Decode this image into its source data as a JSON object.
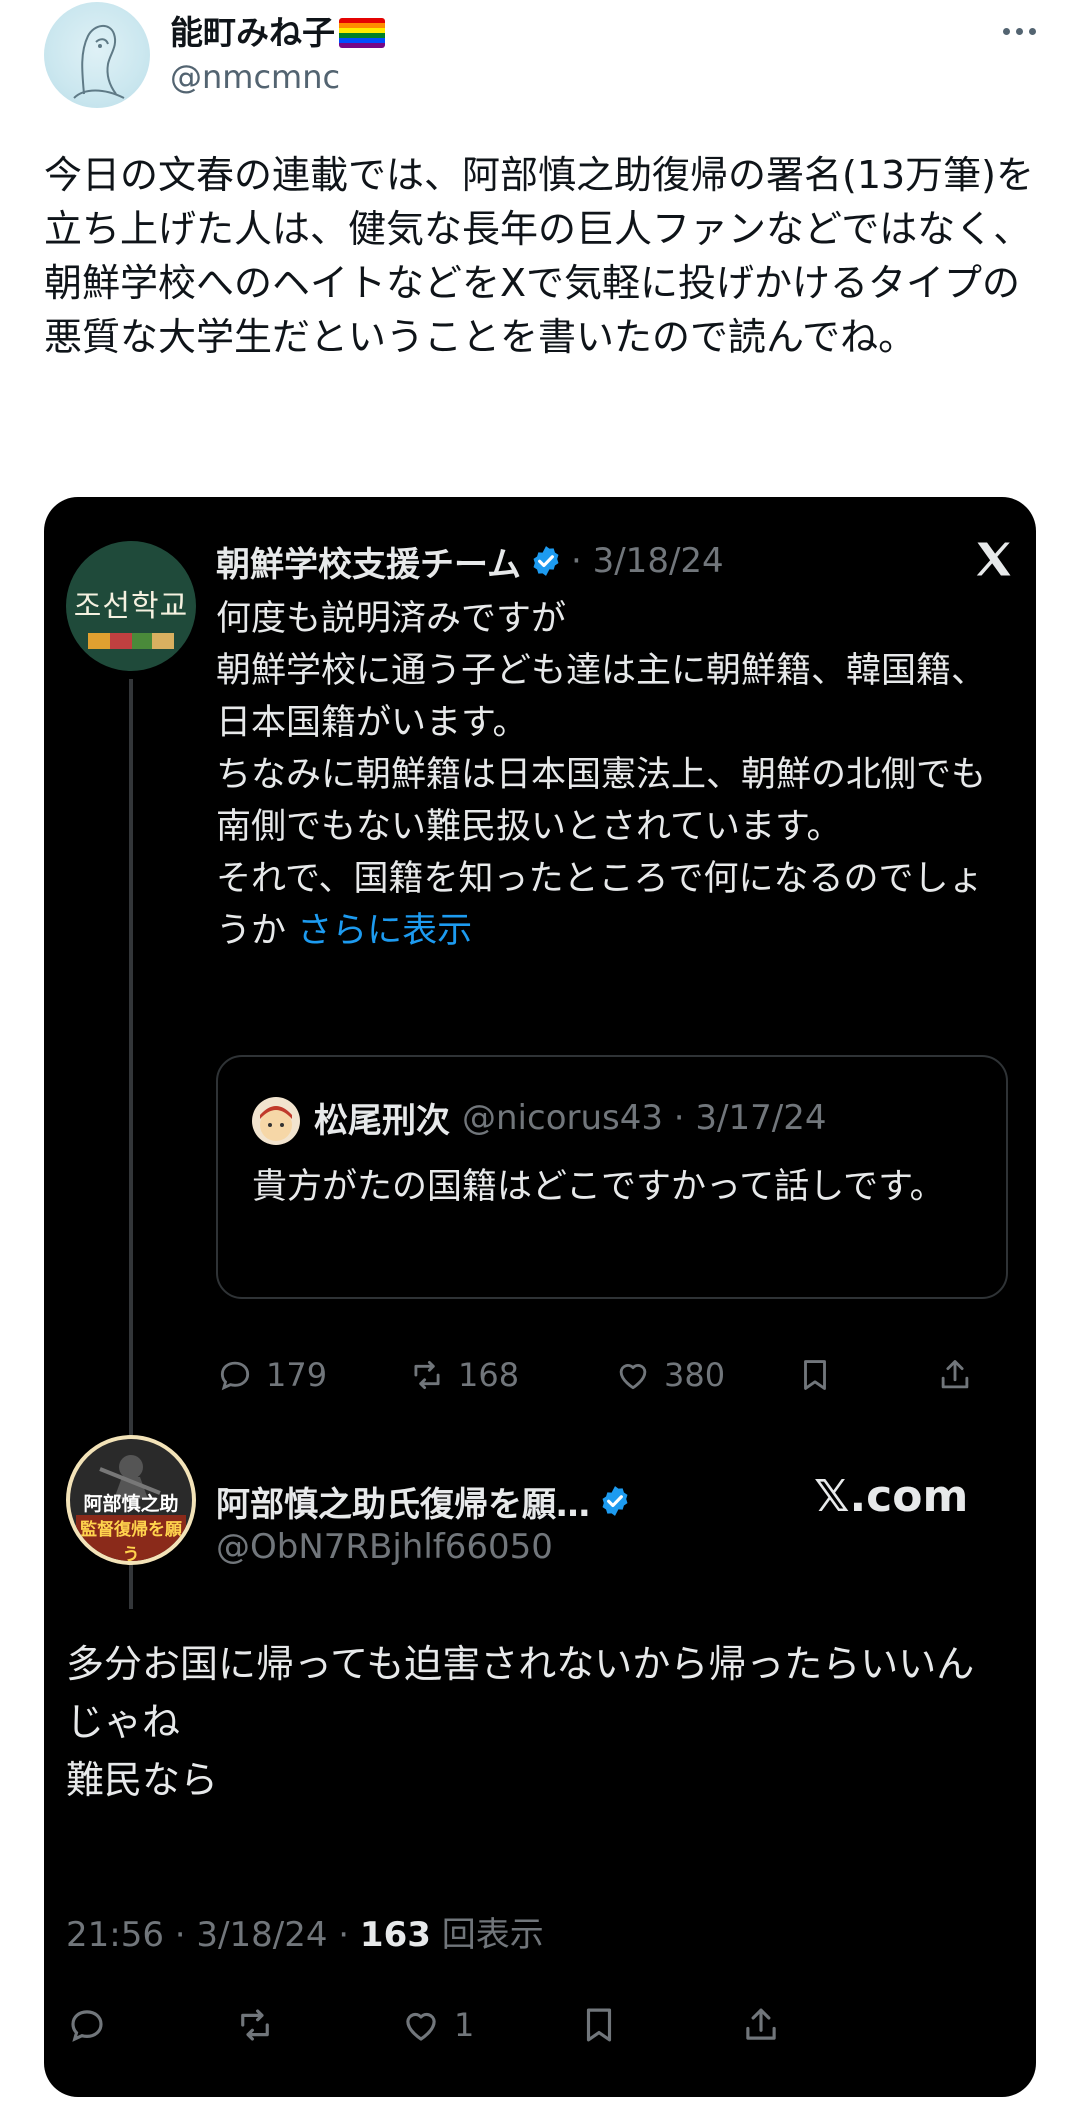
{
  "author": {
    "name": "能町みね子",
    "handle": "@nmcmnc"
  },
  "tweet": {
    "text": "今日の文春の連載では、阿部慎之助復帰の署名(13万筆)を立ち上げた人は、健気な長年の巨人ファンなどではなく、朝鮮学校へのヘイトなどをXで気軽に投げかけるタイプの悪質な大学生だということを書いたので読んでね。"
  },
  "quoted": {
    "name": "朝鮮学校支援チーム",
    "date": "· 3/18/24",
    "body": "何度も説明済みですが\n朝鮮学校に通う子ども達は主に朝鮮籍、韓国籍、日本国籍がいます。\nちなみに朝鮮籍は日本国憲法上、朝鮮の北側でも南側でもない難民扱いとされています。\nそれで、国籍を知ったところで何になるのでしょうか ",
    "show_more": "さらに表示",
    "avatar_text": "조선학교",
    "inner": {
      "name": "松尾刑次",
      "handle": "@nicorus43 · 3/17/24",
      "text": "貴方がたの国籍はどこですかって話しです。"
    },
    "actions": {
      "replies": "179",
      "retweets": "168",
      "likes": "380"
    }
  },
  "reply": {
    "name": "阿部慎之助氏復帰を願…",
    "handle": "@ObN7RBjhlf66050",
    "site": "𝕏.com",
    "avatar_line1": "阿部慎之助",
    "avatar_line2": "監督復帰を願う",
    "body": "多分お国に帰っても迫害されないから帰ったらいいんじゃね\n難民なら",
    "time": "21:56 · 3/18/24 · ",
    "views_count": "163",
    "views_label": " 回表示",
    "likes": "1"
  },
  "colors": {
    "accent": "#1d9bf0",
    "card_bg": "#000000",
    "muted": "#71767b"
  },
  "icons": [
    "more-icon",
    "verified-icon",
    "x-logo-icon",
    "reply-icon",
    "retweet-icon",
    "like-icon",
    "bookmark-icon",
    "share-icon"
  ]
}
